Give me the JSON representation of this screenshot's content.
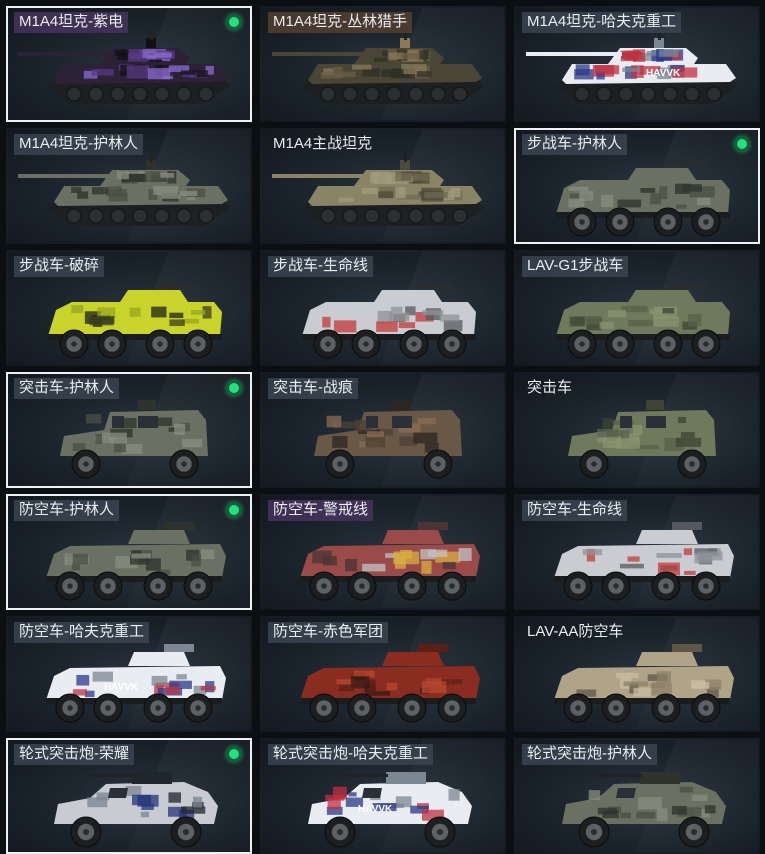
{
  "vehicles": [
    {
      "label": "M1A4坦克-紫电",
      "type": "tank",
      "camo": "purple",
      "selected": true,
      "equipped": true,
      "tag": "purple"
    },
    {
      "label": "M1A4坦克-丛林猎手",
      "type": "tank",
      "camo": "woodland",
      "selected": false,
      "equipped": false,
      "tag": "brown"
    },
    {
      "label": "M1A4坦克-哈夫克重工",
      "type": "tank",
      "camo": "havk",
      "selected": false,
      "equipped": false,
      "tag": "default"
    },
    {
      "label": "M1A4坦克-护林人",
      "type": "tank",
      "camo": "digital",
      "selected": false,
      "equipped": false,
      "tag": "default"
    },
    {
      "label": "M1A4主战坦克",
      "type": "tank",
      "camo": "olive",
      "selected": false,
      "equipped": false,
      "tag": "plain"
    },
    {
      "label": "步战车-护林人",
      "type": "ifv",
      "camo": "digital",
      "selected": true,
      "equipped": true,
      "tag": "default"
    },
    {
      "label": "步战车-破碎",
      "type": "ifv",
      "camo": "yellow",
      "selected": false,
      "equipped": false,
      "tag": "default"
    },
    {
      "label": "步战车-生命线",
      "type": "ifv",
      "camo": "lifeline",
      "selected": false,
      "equipped": false,
      "tag": "default"
    },
    {
      "label": "LAV-G1步战车",
      "type": "ifv",
      "camo": "green",
      "selected": false,
      "equipped": false,
      "tag": "default"
    },
    {
      "label": "突击车-护林人",
      "type": "assault",
      "camo": "digital",
      "selected": true,
      "equipped": true,
      "tag": "default"
    },
    {
      "label": "突击车-战痕",
      "type": "assault",
      "camo": "rust",
      "selected": false,
      "equipped": false,
      "tag": "default"
    },
    {
      "label": "突击车",
      "type": "assault",
      "camo": "green",
      "selected": false,
      "equipped": false,
      "tag": "plain"
    },
    {
      "label": "防空车-护林人",
      "type": "aa",
      "camo": "digital",
      "selected": true,
      "equipped": true,
      "tag": "default"
    },
    {
      "label": "防空车-警戒线",
      "type": "aa",
      "camo": "warning",
      "selected": false,
      "equipped": false,
      "tag": "purple"
    },
    {
      "label": "防空车-生命线",
      "type": "aa",
      "camo": "lifeline",
      "selected": false,
      "equipped": false,
      "tag": "default"
    },
    {
      "label": "防空车-哈夫克重工",
      "type": "aa",
      "camo": "havk",
      "selected": false,
      "equipped": false,
      "tag": "default"
    },
    {
      "label": "防空车-赤色军团",
      "type": "aa",
      "camo": "red",
      "selected": false,
      "equipped": false,
      "tag": "default"
    },
    {
      "label": "LAV-AA防空车",
      "type": "aa",
      "camo": "tan",
      "selected": false,
      "equipped": false,
      "tag": "plain"
    },
    {
      "label": "轮式突击炮-荣耀",
      "type": "wheeled",
      "camo": "glory",
      "selected": true,
      "equipped": true,
      "tag": "default"
    },
    {
      "label": "轮式突击炮-哈夫克重工",
      "type": "wheeled",
      "camo": "havk",
      "selected": false,
      "equipped": false,
      "tag": "default"
    },
    {
      "label": "轮式突击炮-护林人",
      "type": "wheeled",
      "camo": "digital",
      "selected": false,
      "equipped": false,
      "tag": "default"
    }
  ],
  "havk_mark": "HAVVK",
  "icons": {
    "equipped": "green-dot-icon"
  },
  "colors": {
    "selected_border": "#eef1f3",
    "equipped_dot": "#27e07a",
    "background": "#0c0f12"
  }
}
